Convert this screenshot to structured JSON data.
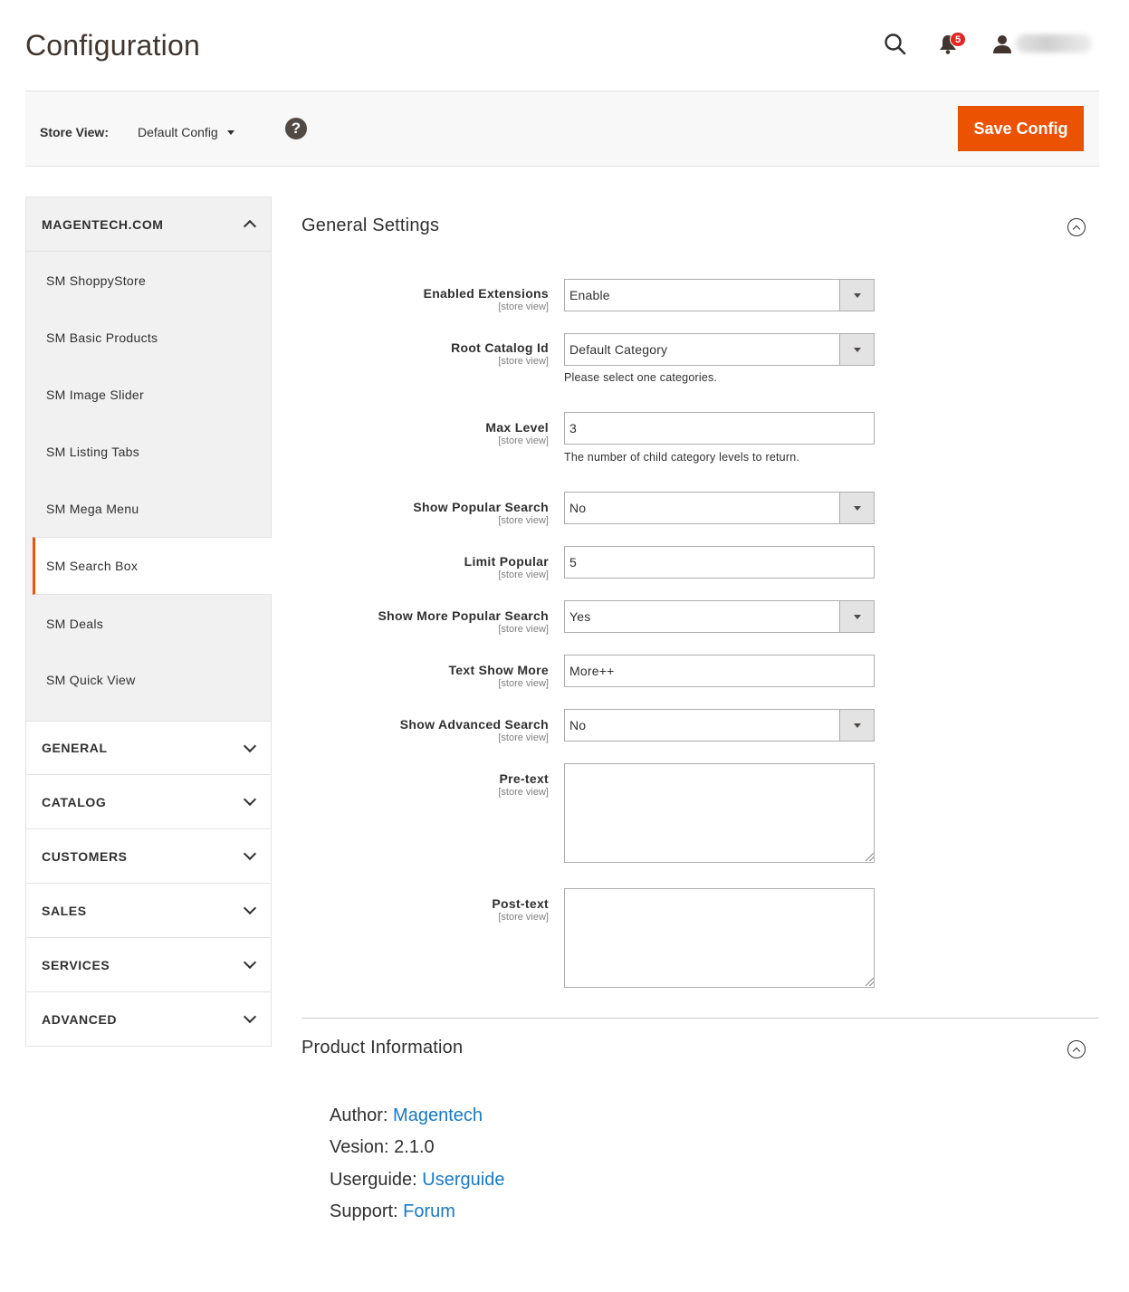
{
  "header": {
    "title": "Configuration",
    "notification_count": "5",
    "icons": [
      "search-icon",
      "bell-icon",
      "user-icon"
    ]
  },
  "store_bar": {
    "label": "Store View:",
    "selected": "Default Config",
    "help_symbol": "?",
    "save_label": "Save Config"
  },
  "sidebar": {
    "top_section": "MAGENTECH.COM",
    "items": [
      {
        "label": "SM ShoppyStore"
      },
      {
        "label": "SM Basic Products"
      },
      {
        "label": "SM Image Slider"
      },
      {
        "label": "SM Listing Tabs"
      },
      {
        "label": "SM Mega Menu"
      },
      {
        "label": "SM Search Box",
        "active": true
      },
      {
        "label": "SM Deals"
      },
      {
        "label": "SM Quick View"
      }
    ],
    "sections": [
      "GENERAL",
      "CATALOG",
      "CUSTOMERS",
      "SALES",
      "SERVICES",
      "ADVANCED"
    ]
  },
  "general_settings": {
    "title": "General Settings",
    "scope": "[store view]",
    "fields": {
      "enabled_extensions": {
        "label": "Enabled Extensions",
        "value": "Enable"
      },
      "root_catalog_id": {
        "label": "Root Catalog Id",
        "value": "Default Category",
        "note": "Please select one categories."
      },
      "max_level": {
        "label": "Max Level",
        "value": "3",
        "note": "The number of child category levels to return."
      },
      "show_popular_search": {
        "label": "Show Popular Search",
        "value": "No"
      },
      "limit_popular": {
        "label": "Limit Popular",
        "value": "5"
      },
      "show_more_popular_search": {
        "label": "Show More Popular Search",
        "value": "Yes"
      },
      "text_show_more": {
        "label": "Text Show More",
        "value": "More++"
      },
      "show_advanced_search": {
        "label": "Show Advanced Search",
        "value": "No"
      },
      "pre_text": {
        "label": "Pre-text",
        "value": ""
      },
      "post_text": {
        "label": "Post-text",
        "value": ""
      }
    }
  },
  "product_information": {
    "title": "Product Information",
    "author_label": "Author:",
    "author_value": "Magentech",
    "version_label": "Vesion:",
    "version_value": "2.1.0",
    "userguide_label": "Userguide:",
    "userguide_value": "Userguide",
    "support_label": "Support:",
    "support_value": "Forum"
  },
  "colors": {
    "accent": "#eb5202",
    "link": "#1979c3",
    "badge": "#e22626"
  }
}
